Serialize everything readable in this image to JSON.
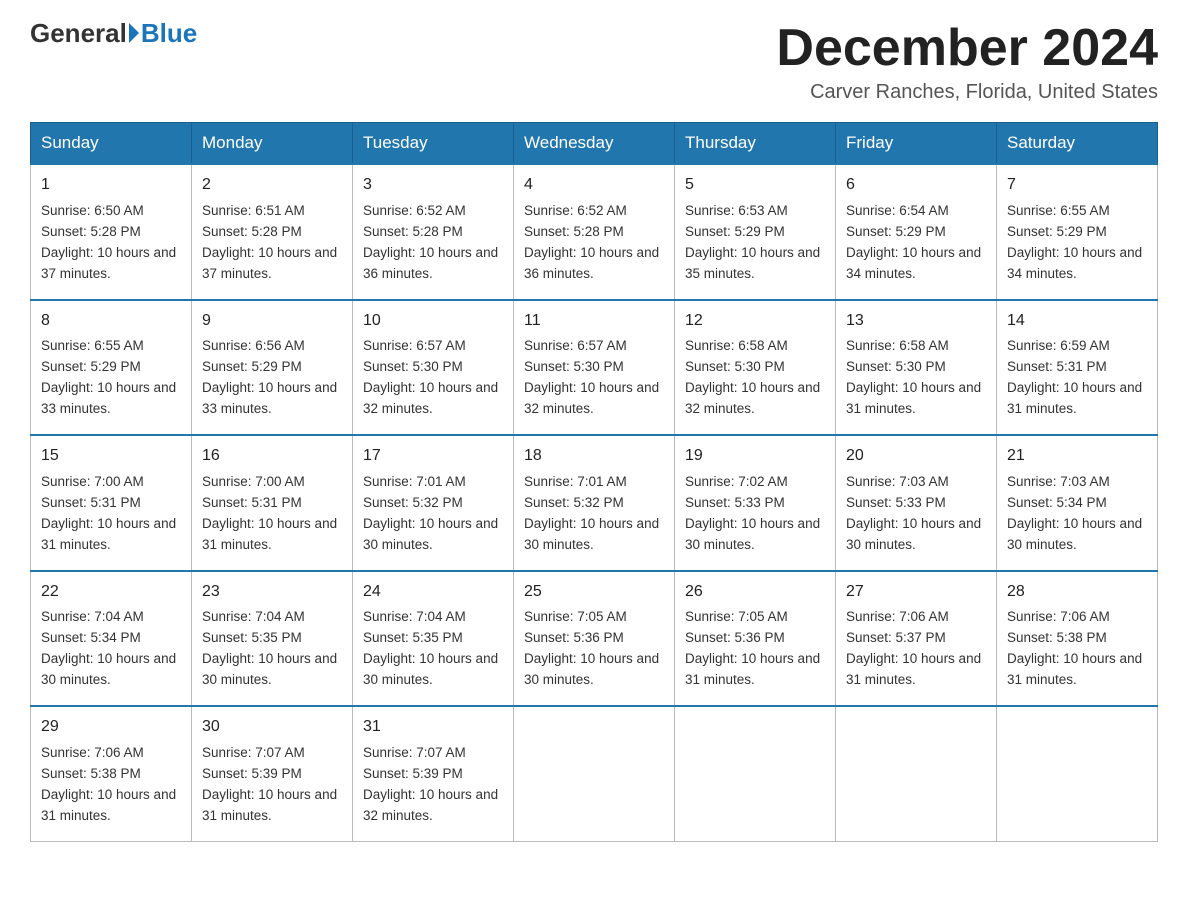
{
  "header": {
    "logo_general": "General",
    "logo_blue": "Blue",
    "month_title": "December 2024",
    "location": "Carver Ranches, Florida, United States"
  },
  "days_of_week": [
    "Sunday",
    "Monday",
    "Tuesday",
    "Wednesday",
    "Thursday",
    "Friday",
    "Saturday"
  ],
  "weeks": [
    [
      {
        "day": "1",
        "sunrise": "6:50 AM",
        "sunset": "5:28 PM",
        "daylight": "10 hours and 37 minutes."
      },
      {
        "day": "2",
        "sunrise": "6:51 AM",
        "sunset": "5:28 PM",
        "daylight": "10 hours and 37 minutes."
      },
      {
        "day": "3",
        "sunrise": "6:52 AM",
        "sunset": "5:28 PM",
        "daylight": "10 hours and 36 minutes."
      },
      {
        "day": "4",
        "sunrise": "6:52 AM",
        "sunset": "5:28 PM",
        "daylight": "10 hours and 36 minutes."
      },
      {
        "day": "5",
        "sunrise": "6:53 AM",
        "sunset": "5:29 PM",
        "daylight": "10 hours and 35 minutes."
      },
      {
        "day": "6",
        "sunrise": "6:54 AM",
        "sunset": "5:29 PM",
        "daylight": "10 hours and 34 minutes."
      },
      {
        "day": "7",
        "sunrise": "6:55 AM",
        "sunset": "5:29 PM",
        "daylight": "10 hours and 34 minutes."
      }
    ],
    [
      {
        "day": "8",
        "sunrise": "6:55 AM",
        "sunset": "5:29 PM",
        "daylight": "10 hours and 33 minutes."
      },
      {
        "day": "9",
        "sunrise": "6:56 AM",
        "sunset": "5:29 PM",
        "daylight": "10 hours and 33 minutes."
      },
      {
        "day": "10",
        "sunrise": "6:57 AM",
        "sunset": "5:30 PM",
        "daylight": "10 hours and 32 minutes."
      },
      {
        "day": "11",
        "sunrise": "6:57 AM",
        "sunset": "5:30 PM",
        "daylight": "10 hours and 32 minutes."
      },
      {
        "day": "12",
        "sunrise": "6:58 AM",
        "sunset": "5:30 PM",
        "daylight": "10 hours and 32 minutes."
      },
      {
        "day": "13",
        "sunrise": "6:58 AM",
        "sunset": "5:30 PM",
        "daylight": "10 hours and 31 minutes."
      },
      {
        "day": "14",
        "sunrise": "6:59 AM",
        "sunset": "5:31 PM",
        "daylight": "10 hours and 31 minutes."
      }
    ],
    [
      {
        "day": "15",
        "sunrise": "7:00 AM",
        "sunset": "5:31 PM",
        "daylight": "10 hours and 31 minutes."
      },
      {
        "day": "16",
        "sunrise": "7:00 AM",
        "sunset": "5:31 PM",
        "daylight": "10 hours and 31 minutes."
      },
      {
        "day": "17",
        "sunrise": "7:01 AM",
        "sunset": "5:32 PM",
        "daylight": "10 hours and 30 minutes."
      },
      {
        "day": "18",
        "sunrise": "7:01 AM",
        "sunset": "5:32 PM",
        "daylight": "10 hours and 30 minutes."
      },
      {
        "day": "19",
        "sunrise": "7:02 AM",
        "sunset": "5:33 PM",
        "daylight": "10 hours and 30 minutes."
      },
      {
        "day": "20",
        "sunrise": "7:03 AM",
        "sunset": "5:33 PM",
        "daylight": "10 hours and 30 minutes."
      },
      {
        "day": "21",
        "sunrise": "7:03 AM",
        "sunset": "5:34 PM",
        "daylight": "10 hours and 30 minutes."
      }
    ],
    [
      {
        "day": "22",
        "sunrise": "7:04 AM",
        "sunset": "5:34 PM",
        "daylight": "10 hours and 30 minutes."
      },
      {
        "day": "23",
        "sunrise": "7:04 AM",
        "sunset": "5:35 PM",
        "daylight": "10 hours and 30 minutes."
      },
      {
        "day": "24",
        "sunrise": "7:04 AM",
        "sunset": "5:35 PM",
        "daylight": "10 hours and 30 minutes."
      },
      {
        "day": "25",
        "sunrise": "7:05 AM",
        "sunset": "5:36 PM",
        "daylight": "10 hours and 30 minutes."
      },
      {
        "day": "26",
        "sunrise": "7:05 AM",
        "sunset": "5:36 PM",
        "daylight": "10 hours and 31 minutes."
      },
      {
        "day": "27",
        "sunrise": "7:06 AM",
        "sunset": "5:37 PM",
        "daylight": "10 hours and 31 minutes."
      },
      {
        "day": "28",
        "sunrise": "7:06 AM",
        "sunset": "5:38 PM",
        "daylight": "10 hours and 31 minutes."
      }
    ],
    [
      {
        "day": "29",
        "sunrise": "7:06 AM",
        "sunset": "5:38 PM",
        "daylight": "10 hours and 31 minutes."
      },
      {
        "day": "30",
        "sunrise": "7:07 AM",
        "sunset": "5:39 PM",
        "daylight": "10 hours and 31 minutes."
      },
      {
        "day": "31",
        "sunrise": "7:07 AM",
        "sunset": "5:39 PM",
        "daylight": "10 hours and 32 minutes."
      },
      null,
      null,
      null,
      null
    ]
  ],
  "labels": {
    "sunrise": "Sunrise:",
    "sunset": "Sunset:",
    "daylight": "Daylight:"
  }
}
